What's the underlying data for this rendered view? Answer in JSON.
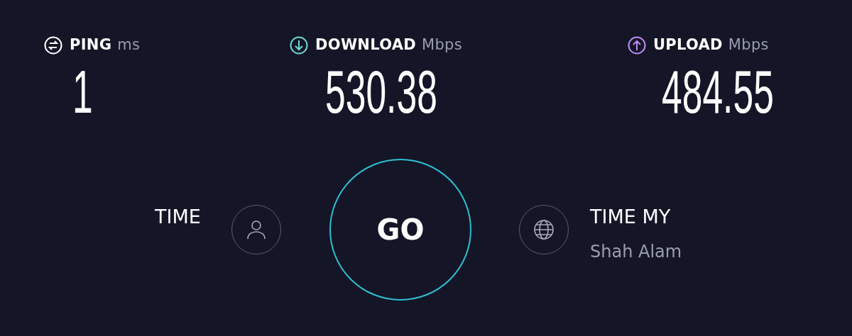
{
  "metrics": [
    {
      "kind": "ping",
      "label": "PING",
      "unit": "ms",
      "value": "1",
      "color": "#ffffff"
    },
    {
      "kind": "download",
      "label": "DOWNLOAD",
      "unit": "Mbps",
      "value": "530.38",
      "color": "#6fd9d0"
    },
    {
      "kind": "upload",
      "label": "UPLOAD",
      "unit": "Mbps",
      "value": "484.55",
      "color": "#c18cf0"
    }
  ],
  "provider": {
    "name": "TIME"
  },
  "go_button": {
    "label": "GO"
  },
  "server": {
    "name": "TIME MY",
    "location": "Shah Alam"
  }
}
